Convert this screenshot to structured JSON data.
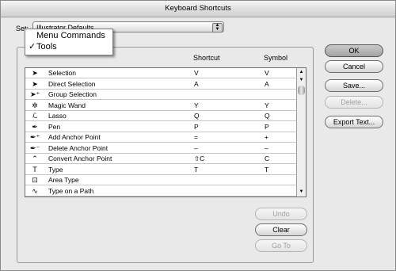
{
  "window": {
    "title": "Keyboard Shortcuts"
  },
  "set": {
    "label": "Set:",
    "value": "Illustrator Defaults"
  },
  "popup_menu": {
    "items": [
      {
        "check": "",
        "label": "Menu Commands"
      },
      {
        "check": "✓",
        "label": "Tools"
      }
    ]
  },
  "columns": {
    "shortcut": "Shortcut",
    "symbol": "Symbol"
  },
  "rows": [
    {
      "icon": "selection-arrow-icon",
      "glyph": "➤",
      "name": "Selection",
      "shortcut": "V",
      "symbol": "V"
    },
    {
      "icon": "direct-selection-arrow-icon",
      "glyph": "➤",
      "name": "Direct Selection",
      "shortcut": "A",
      "symbol": "A"
    },
    {
      "icon": "group-selection-arrow-icon",
      "glyph": "➤⁺",
      "name": "Group Selection",
      "shortcut": "",
      "symbol": ""
    },
    {
      "icon": "magic-wand-icon",
      "glyph": "✲",
      "name": "Magic Wand",
      "shortcut": "Y",
      "symbol": "Y"
    },
    {
      "icon": "lasso-icon",
      "glyph": "ℒ",
      "name": "Lasso",
      "shortcut": "Q",
      "symbol": "Q"
    },
    {
      "icon": "pen-icon",
      "glyph": "✒",
      "name": "Pen",
      "shortcut": "P",
      "symbol": "P"
    },
    {
      "icon": "add-anchor-point-icon",
      "glyph": "✒⁺",
      "name": "Add Anchor Point",
      "shortcut": "=",
      "symbol": "+"
    },
    {
      "icon": "delete-anchor-point-icon",
      "glyph": "✒⁻",
      "name": "Delete Anchor Point",
      "shortcut": "–",
      "symbol": "–"
    },
    {
      "icon": "convert-anchor-point-icon",
      "glyph": "⌃",
      "name": "Convert Anchor Point",
      "shortcut": "⇧C",
      "symbol": "C"
    },
    {
      "icon": "type-icon",
      "glyph": "T",
      "name": "Type",
      "shortcut": "T",
      "symbol": "T"
    },
    {
      "icon": "area-type-icon",
      "glyph": "⊡",
      "name": "Area Type",
      "shortcut": "",
      "symbol": ""
    },
    {
      "icon": "type-on-path-icon",
      "glyph": "∿",
      "name": "Type on a Path",
      "shortcut": "",
      "symbol": ""
    }
  ],
  "buttons": {
    "ok": "OK",
    "cancel": "Cancel",
    "save": "Save...",
    "delete": "Delete...",
    "export": "Export Text...",
    "undo": "Undo",
    "clear": "Clear",
    "goto": "Go To"
  }
}
